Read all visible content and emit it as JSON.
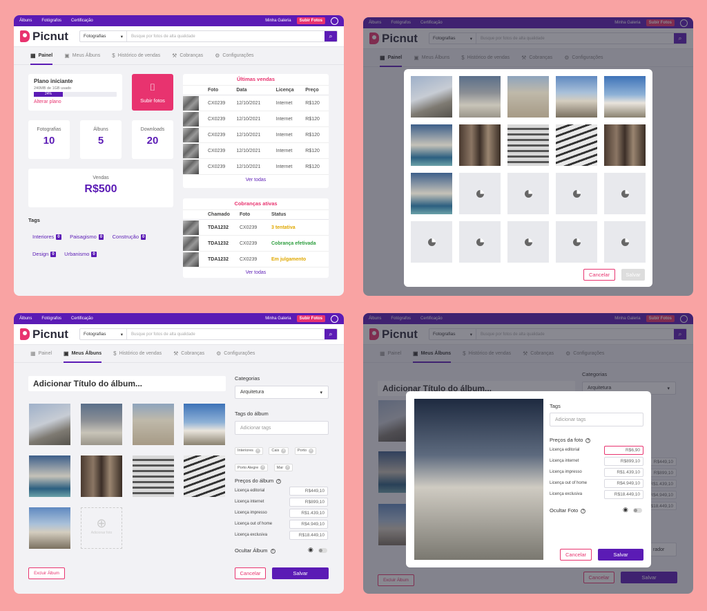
{
  "topbar": {
    "albums": "Álbuns",
    "photographers": "Fotógrafos",
    "certification": "Certificação",
    "gallery": "Minha Galeria",
    "upload": "Subir Fotos"
  },
  "header": {
    "logo": "Picnut",
    "category": "Fotografias",
    "search_placeholder": "Busque por fotos de alta qualidade"
  },
  "tabs": [
    "Painel",
    "Meus Álbuns",
    "Histórico de vendas",
    "Cobranças",
    "Configurações"
  ],
  "tab_icons": [
    "grid-icon",
    "image-icon",
    "dollar-icon",
    "gavel-icon",
    "gear-icon"
  ],
  "dashboard": {
    "plan": {
      "title": "Plano iniciante",
      "usage": "240MB de 1GB usado",
      "percent_label": "24%",
      "percent": 0.24,
      "change": "Alterar plano"
    },
    "upload_label": "Subir fotos",
    "stats": [
      {
        "label": "Fotografias",
        "value": "10"
      },
      {
        "label": "Álbuns",
        "value": "5"
      },
      {
        "label": "Downloads",
        "value": "20"
      }
    ],
    "sales": {
      "label": "Vendas",
      "value": "R$500"
    },
    "tags_title": "Tags",
    "tags": [
      {
        "name": "Interiores",
        "count": "0"
      },
      {
        "name": "Paisagismo",
        "count": "0"
      },
      {
        "name": "Construção",
        "count": "0"
      },
      {
        "name": "Design",
        "count": "0"
      },
      {
        "name": "Urbanismo",
        "count": "0"
      }
    ],
    "last_sales": {
      "title": "Últimas vendas",
      "headers": [
        "Foto",
        "Data",
        "Licença",
        "Preço"
      ],
      "rows": [
        [
          "CX0239",
          "12/10/2021",
          "Internet",
          "R$120"
        ],
        [
          "CX0239",
          "12/10/2021",
          "Internet",
          "R$120"
        ],
        [
          "CX0239",
          "12/10/2021",
          "Internet",
          "R$120"
        ],
        [
          "CX0239",
          "12/10/2021",
          "Internet",
          "R$120"
        ],
        [
          "CX0239",
          "12/10/2021",
          "Internet",
          "R$120"
        ]
      ],
      "see_all": "Ver todas"
    },
    "charges": {
      "title": "Cobranças ativas",
      "headers": [
        "Chamado",
        "Foto",
        "Status"
      ],
      "rows": [
        {
          "id": "TDA1232",
          "photo": "CX0239",
          "status": "3 tentativa",
          "color": "#e0a800"
        },
        {
          "id": "TDA1232",
          "photo": "CX0239",
          "status": "Cobrança efetivada",
          "color": "#2e9e3f"
        },
        {
          "id": "TDA1232",
          "photo": "CX0239",
          "status": "Em julgamento",
          "color": "#e0a800"
        }
      ],
      "see_all": "Ver todas"
    }
  },
  "picker": {
    "cancel": "Cancelar",
    "save": "Salvar"
  },
  "album": {
    "title_placeholder": "Adicionar Título do álbum...",
    "add_photo": "Adicionar foto",
    "categories_label": "Categorias",
    "category": "Arquitetura",
    "tags_label": "Tags do álbum",
    "tags_placeholder": "Adicionar tags",
    "tags": [
      "Interiores",
      "Cais",
      "Porto",
      "Porto Alegre",
      "Mar"
    ],
    "prices_label": "Preços do álbum",
    "prices": [
      {
        "label": "Licença editorial",
        "value": "R$449,10"
      },
      {
        "label": "Licença internet",
        "value": "R$899,10"
      },
      {
        "label": "Licença impresso",
        "value": "R$1.439,10"
      },
      {
        "label": "Licença out of home",
        "value": "R$4.949,10"
      },
      {
        "label": "Licença exclusiva",
        "value": "R$18.449,10"
      }
    ],
    "hide_label": "Ocultar Álbum",
    "delete": "Excluir Álbum",
    "cancel": "Cancelar",
    "save": "Salvar"
  },
  "photo_modal": {
    "tags_label": "Tags",
    "tags_placeholder": "Adicionar tags",
    "prices_label": "Preços da foto",
    "prices": [
      {
        "label": "Licença editorial",
        "value": "R$6,90"
      },
      {
        "label": "Licença internet",
        "value": "R$899,10"
      },
      {
        "label": "Licença impresso",
        "value": "R$1.439,10"
      },
      {
        "label": "Licença out of home",
        "value": "R$4.949,10"
      },
      {
        "label": "Licença exclusiva",
        "value": "R$18.449,10"
      }
    ],
    "hide_label": "Ocultar Foto",
    "cancel": "Cancelar",
    "save": "Salvar",
    "bg_partial": "rador"
  }
}
